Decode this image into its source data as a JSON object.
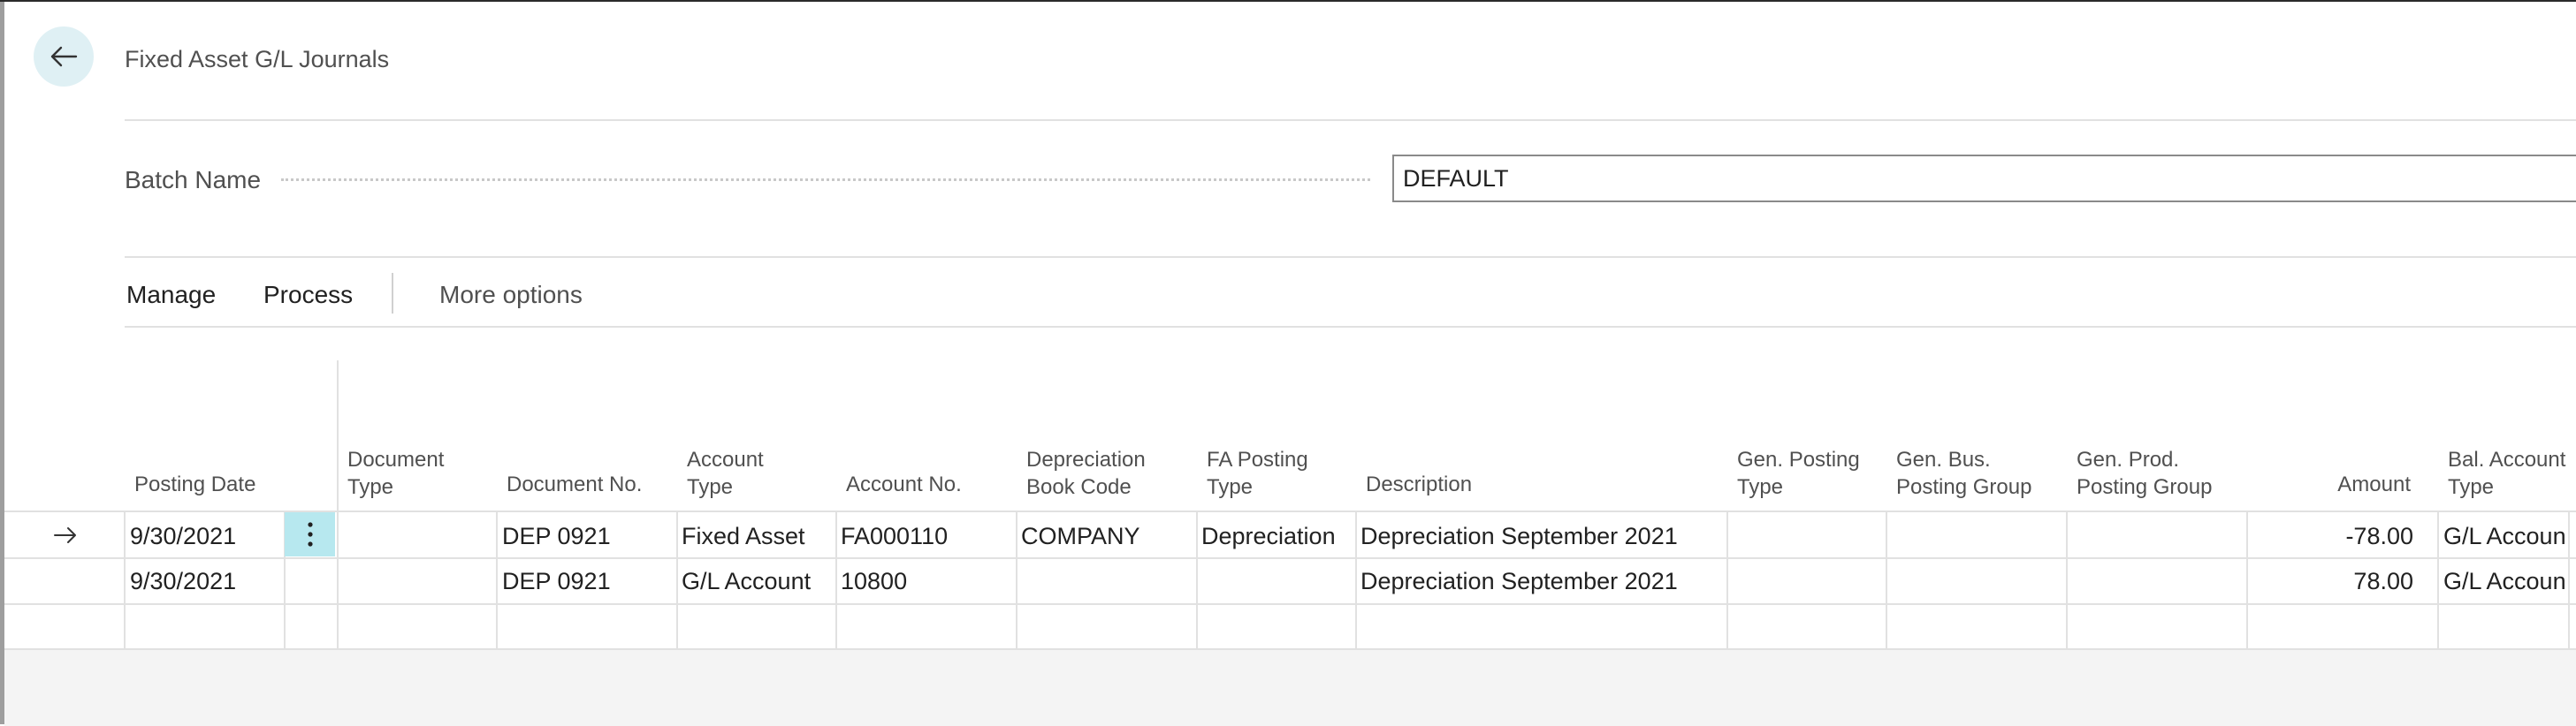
{
  "page": {
    "title": "Fixed Asset G/L Journals"
  },
  "batch": {
    "label": "Batch Name",
    "value": "DEFAULT"
  },
  "actions": {
    "manage": "Manage",
    "process": "Process",
    "more": "More options"
  },
  "columns": {
    "posting_date": "Posting Date",
    "document_type": [
      "Document",
      "Type"
    ],
    "document_no": "Document No.",
    "account_type": [
      "Account",
      "Type"
    ],
    "account_no": "Account No.",
    "depreciation_book_code": [
      "Depreciation",
      "Book Code"
    ],
    "fa_posting_type": [
      "FA Posting",
      "Type"
    ],
    "description": "Description",
    "gen_posting_type": [
      "Gen. Posting",
      "Type"
    ],
    "gen_bus_posting_group": [
      "Gen. Bus.",
      "Posting Group"
    ],
    "gen_prod_posting_group": [
      "Gen. Prod.",
      "Posting Group"
    ],
    "amount": "Amount",
    "bal_account_type": [
      "Bal. Account",
      "Type"
    ]
  },
  "rows": [
    {
      "posting_date": "9/30/2021",
      "document_type": "",
      "document_no": "DEP 0921",
      "account_type": "Fixed Asset",
      "account_no": "FA000110",
      "depreciation_book_code": "COMPANY",
      "fa_posting_type": "Depreciation",
      "description": "Depreciation September 2021",
      "gen_posting_type": "",
      "gen_bus_posting_group": "",
      "gen_prod_posting_group": "",
      "amount": "-78.00",
      "bal_account_type": "G/L Accoun"
    },
    {
      "posting_date": "9/30/2021",
      "document_type": "",
      "document_no": "DEP 0921",
      "account_type": "G/L Account",
      "account_no": "10800",
      "depreciation_book_code": "",
      "fa_posting_type": "",
      "description": "Depreciation September 2021",
      "gen_posting_type": "",
      "gen_bus_posting_group": "",
      "gen_prod_posting_group": "",
      "amount": "78.00",
      "bal_account_type": "G/L Accoun"
    }
  ],
  "icons": {
    "back": "arrow-left-icon",
    "current_row": "arrow-right-icon",
    "row_menu": "vertical-ellipsis-icon"
  },
  "colors": {
    "accent": "#b7e8ef",
    "back_button_bg": "#dff0f4"
  }
}
